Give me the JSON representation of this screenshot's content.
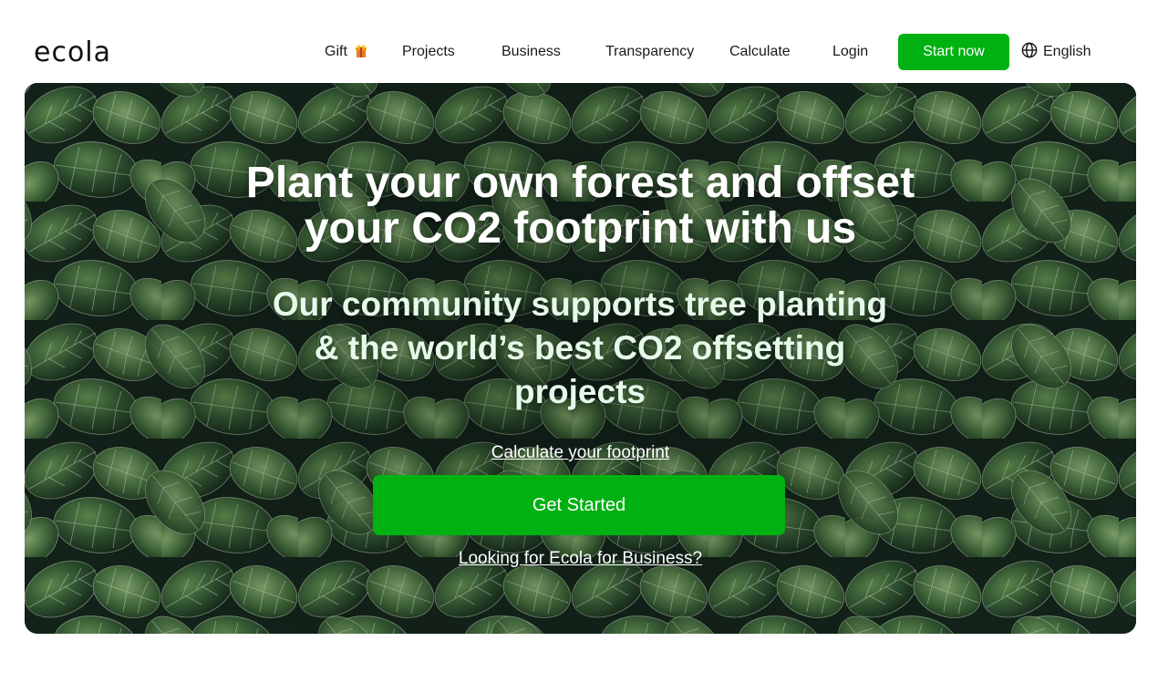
{
  "header": {
    "logo": "ecola",
    "nav": {
      "gift": "Gift",
      "projects": "Projects",
      "business": "Business",
      "transparency": "Transparency",
      "calculate": "Calculate",
      "login": "Login"
    },
    "start_now": "Start now",
    "language": "English",
    "accent_color": "#00b112"
  },
  "hero": {
    "title_line1": "Plant your own forest and offset",
    "title_line2": "your CO2 footprint with us",
    "subtitle": "Our community supports tree planting & the world’s best CO2 offsetting projects",
    "calculate_link": "Calculate your footprint",
    "cta_button": "Get Started",
    "business_link": "Looking for Ecola for Business?"
  },
  "icons": {
    "gift": "gift-icon",
    "globe": "globe-icon"
  }
}
